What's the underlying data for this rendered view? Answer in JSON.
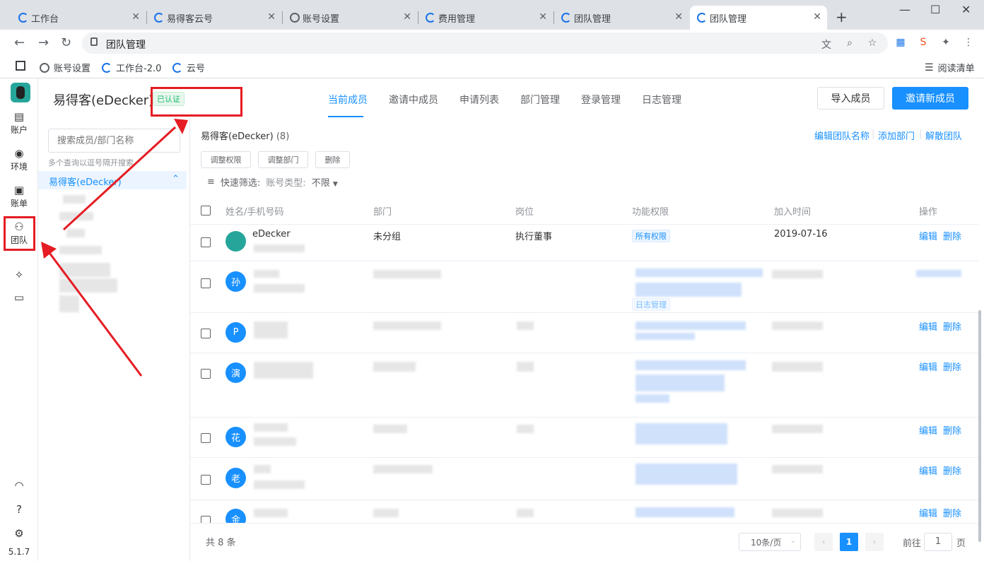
{
  "browser": {
    "tabs": [
      {
        "title": "工作台"
      },
      {
        "title": "易得客云号"
      },
      {
        "title": "账号设置"
      },
      {
        "title": "费用管理"
      },
      {
        "title": "团队管理"
      },
      {
        "title": "团队管理"
      }
    ],
    "active_tab": 5,
    "url": "团队管理",
    "bookmarks": [
      "账号设置",
      "工作台-2.0",
      "云号"
    ],
    "reading_list": "阅读清单"
  },
  "rail": {
    "items": [
      {
        "label": "账户",
        "icon": "store-icon"
      },
      {
        "label": "环境",
        "icon": "globe-icon"
      },
      {
        "label": "账单",
        "icon": "wallet-icon"
      },
      {
        "label": "团队",
        "icon": "users-icon"
      }
    ],
    "version": "5.1.7"
  },
  "header": {
    "team_name": "易得客(eDecker)",
    "verified": "已认证",
    "tabs": [
      "当前成员",
      "邀请中成员",
      "申请列表",
      "部门管理",
      "登录管理",
      "日志管理"
    ],
    "import_button": "导入成员",
    "invite_button": "邀请新成员"
  },
  "sidebar": {
    "search_placeholder": "搜索成员/部门名称",
    "hint": "多个查询以逗号隔开搜索",
    "root": "易得客(eDecker)"
  },
  "main": {
    "team": "易得客(eDecker)",
    "count": "(8)",
    "links": [
      "编辑团队名称",
      "添加部门",
      "解散团队"
    ],
    "actions": [
      "调整权限",
      "调整部门",
      "删除"
    ],
    "filter_label": "快速筛选:",
    "filter_type": "账号类型:",
    "filter_value": "不限",
    "columns": [
      "姓名/手机号码",
      "部门",
      "岗位",
      "功能权限",
      "加入时间",
      "操作"
    ],
    "rows": [
      {
        "avatar": "",
        "name": "eDecker",
        "dept": "未分组",
        "role": "执行董事",
        "perm": "所有权限",
        "joined": "2019-07-16",
        "edit": "编辑",
        "delete": "删除"
      },
      {
        "avatar": "孙",
        "perm_tag": "日志管理",
        "edit": "",
        "delete": ""
      },
      {
        "avatar": "P",
        "edit": "编辑",
        "delete": "删除"
      },
      {
        "avatar": "演",
        "edit": "编辑",
        "delete": "删除"
      },
      {
        "avatar": "花",
        "edit": "编辑",
        "delete": "删除"
      },
      {
        "avatar": "老",
        "edit": "编辑",
        "delete": "删除"
      },
      {
        "avatar": "金",
        "edit": "编辑",
        "delete": "删除"
      }
    ]
  },
  "pagination": {
    "total": "共 8 条",
    "page_size": "10条/页",
    "current": "1",
    "goto_label": "前往",
    "goto_value": "1",
    "goto_unit": "页"
  }
}
